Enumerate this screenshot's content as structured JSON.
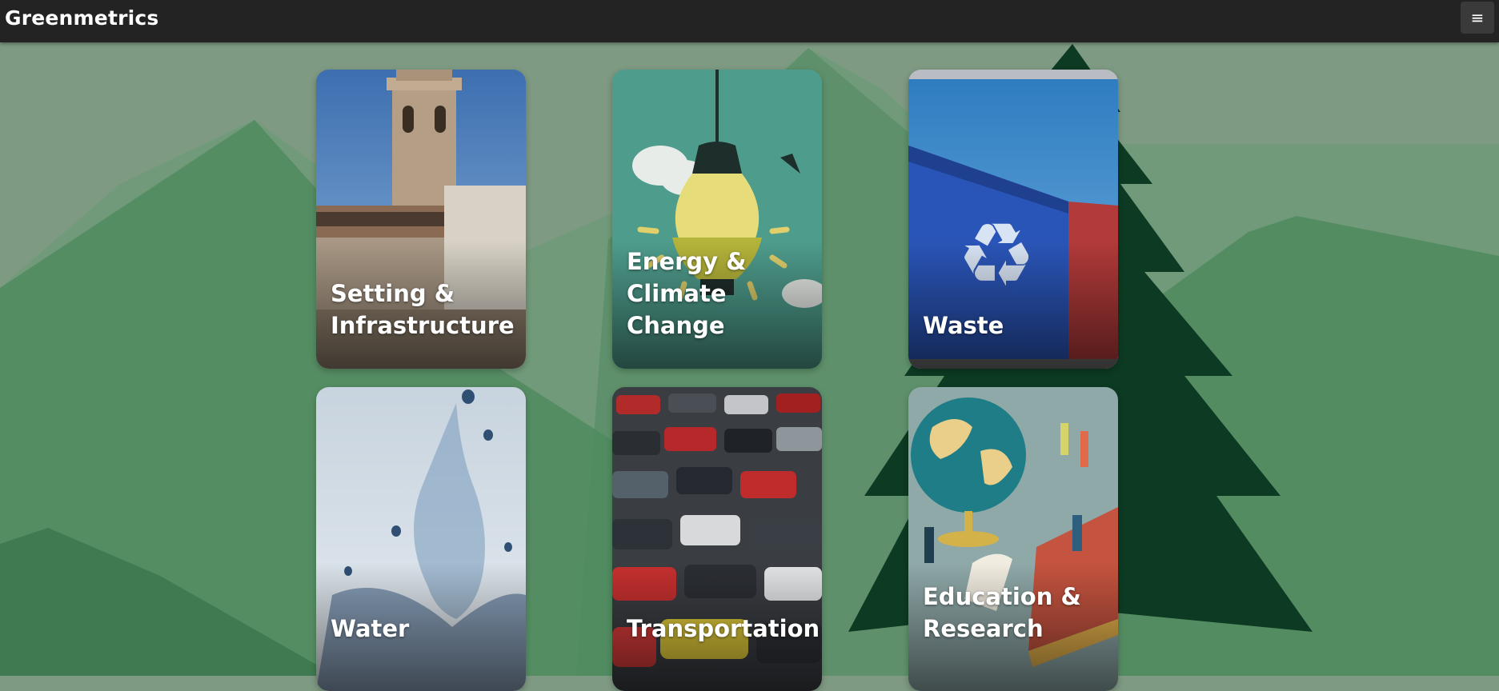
{
  "header": {
    "brand": "Greenmetrics",
    "menu_icon": "hamburger-icon",
    "menu_glyph": "≡"
  },
  "colors": {
    "topbar": "#232323",
    "background": "#7e9a83",
    "mountain": "#4f8a5e",
    "tree": "#0d3a22"
  },
  "cards": [
    {
      "line1": "Setting &",
      "line2": "Infrastructure",
      "image": "bell-tower-building"
    },
    {
      "line1": "Energy &",
      "line2": "Climate Change",
      "image": "lightbulb-wind-turbines"
    },
    {
      "line1": "",
      "line2": "Waste",
      "image": "recycling-bin"
    },
    {
      "line1": "",
      "line2": "Water",
      "image": "water-splash"
    },
    {
      "line1": "",
      "line2": "Transportation",
      "image": "parking-lot-cars"
    },
    {
      "line1": "Education &",
      "line2": "Research",
      "image": "globe-students-books"
    }
  ]
}
